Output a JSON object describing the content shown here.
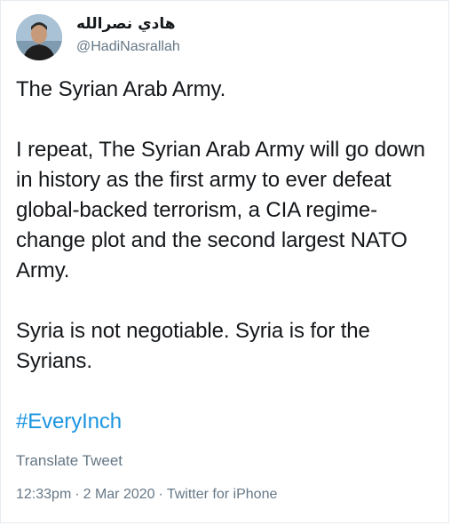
{
  "tweet": {
    "display_name": "هادي نصرالله",
    "handle": "@HadiNasrallah",
    "paragraphs": [
      "The Syrian Arab Army.",
      "I repeat, The Syrian Arab Army will go down in history as the first army to ever defeat global-backed terrorism, a CIA regime-change plot and the second largest NATO Army.",
      "Syria is not negotiable. Syria is for the Syrians."
    ],
    "hashtag": "#EveryInch",
    "translate_label": "Translate Tweet",
    "time": "12:33pm",
    "separator": "·",
    "date": "2 Mar 2020",
    "source": "Twitter for iPhone"
  },
  "colors": {
    "text": "#14171a",
    "muted": "#657786",
    "link": "#1b95e0",
    "border": "#e6ecf0"
  },
  "icons": {
    "avatar": "profile-photo"
  }
}
